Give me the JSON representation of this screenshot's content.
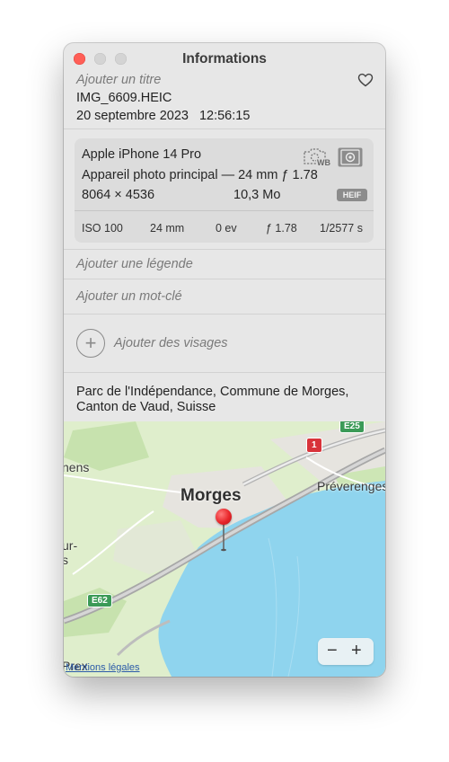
{
  "window": {
    "title": "Informations"
  },
  "photo": {
    "title_placeholder": "Ajouter un titre",
    "filename": "IMG_6609.HEIC",
    "date": "20 septembre 2023",
    "time": "12:56:15"
  },
  "camera": {
    "device": "Apple iPhone 14 Pro",
    "lens": "Appareil photo principal — 24 mm ƒ 1.78",
    "resolution": "8064 × 4536",
    "size": "10,3 Mo",
    "format_badge": "HEIF",
    "wb_label": "WB",
    "stats": {
      "iso": "ISO 100",
      "focal": "24 mm",
      "ev": "0 ev",
      "aperture": "ƒ 1.78",
      "shutter": "1/2577 s"
    }
  },
  "fields": {
    "caption_placeholder": "Ajouter une légende",
    "keyword_placeholder": "Ajouter un mot-clé",
    "faces_label": "Ajouter des visages",
    "add_icon": "+"
  },
  "location": {
    "line1": "Parc de l'Indépendance, Commune de Morges,",
    "line2": "Canton de Vaud, Suisse"
  },
  "map": {
    "city": "Morges",
    "town_right": "Préverenges",
    "partial_left_top": "nens",
    "partial_left_mid1": "ur-",
    "partial_left_mid2": "s",
    "partial_left_bottom": "Prex",
    "road_e62": "E62",
    "road_e25": "E25",
    "road_1": "1",
    "legal": "Mentions légales",
    "zoom_out": "−",
    "zoom_in": "+"
  },
  "colors": {
    "close": "#ff5f57",
    "water": "#8fd4ee",
    "land": "#dfeecc",
    "pin": "#e8262a",
    "road_badge": "#3b9a57"
  },
  "icons": [
    "heart-icon",
    "raw-wb-camera-icon",
    "exposure-camera-icon",
    "add-faces-icon",
    "location-pin-icon"
  ]
}
